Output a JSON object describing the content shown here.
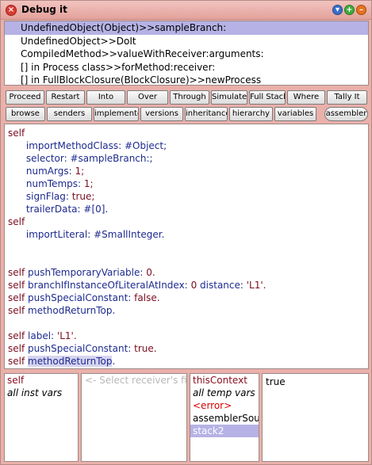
{
  "window": {
    "title": "Debug it"
  },
  "stack": [
    "UndefinedObject(Object)>>sampleBranch:",
    "UndefinedObject>>DoIt",
    "CompiledMethod>>valueWithReceiver:arguments:",
    "[] in Process class>>forMethod:receiver:",
    "[] in FullBlockClosure(BlockClosure)>>newProcess"
  ],
  "buttons_row1": [
    "Proceed",
    "Restart",
    "Into",
    "Over",
    "Through",
    "Simulate",
    "Full Stack",
    "Where",
    "Tally It"
  ],
  "buttons_row2": [
    "browse",
    "senders",
    "implementors",
    "versions",
    "inheritance",
    "hierarchy",
    "variables",
    "assembler"
  ],
  "code": {
    "l1": "self",
    "l2_sel": "importMethodClass:",
    "l2_arg": "#Object;",
    "l3_sel": "selector:",
    "l3_arg": "#sampleBranch:;",
    "l4_sel": "numArgs:",
    "l4_arg": "1;",
    "l5_sel": "numTemps:",
    "l5_arg": "1;",
    "l6_sel": "signFlag:",
    "l6_arg": "true;",
    "l7_sel": "trailerData:",
    "l7_arg": "#[0].",
    "l8": "self",
    "l9_sel": "importLiteral:",
    "l9_arg": "#SmallInteger.",
    "l12_self": "self",
    "l12_sel": "pushTemporaryVariable:",
    "l12_arg": "0.",
    "l13_self": "self",
    "l13_sel1": "branchIfInstanceOfLiteralAtIndex:",
    "l13_arg1": "0",
    "l13_sel2": "distance:",
    "l13_arg2": "'L1'.",
    "l14_self": "self",
    "l14_sel": "pushSpecialConstant:",
    "l14_arg": "false.",
    "l15_self": "self",
    "l15_sel": "methodReturnTop.",
    "l17_self": "self",
    "l17_sel": "label:",
    "l17_arg": "'L1'.",
    "l18_self": "self",
    "l18_sel": "pushSpecialConstant:",
    "l18_arg": "true.",
    "l19_self": "self",
    "l19_sel": "methodReturnTop",
    "l19_end": "."
  },
  "receiver_list": [
    "self",
    "all inst vars"
  ],
  "receiver_value": "<- Select receiver's field",
  "context_list": [
    "thisContext",
    "all temp vars",
    "<error>",
    "assemblerSource",
    "stack2"
  ],
  "context_value": "true"
}
